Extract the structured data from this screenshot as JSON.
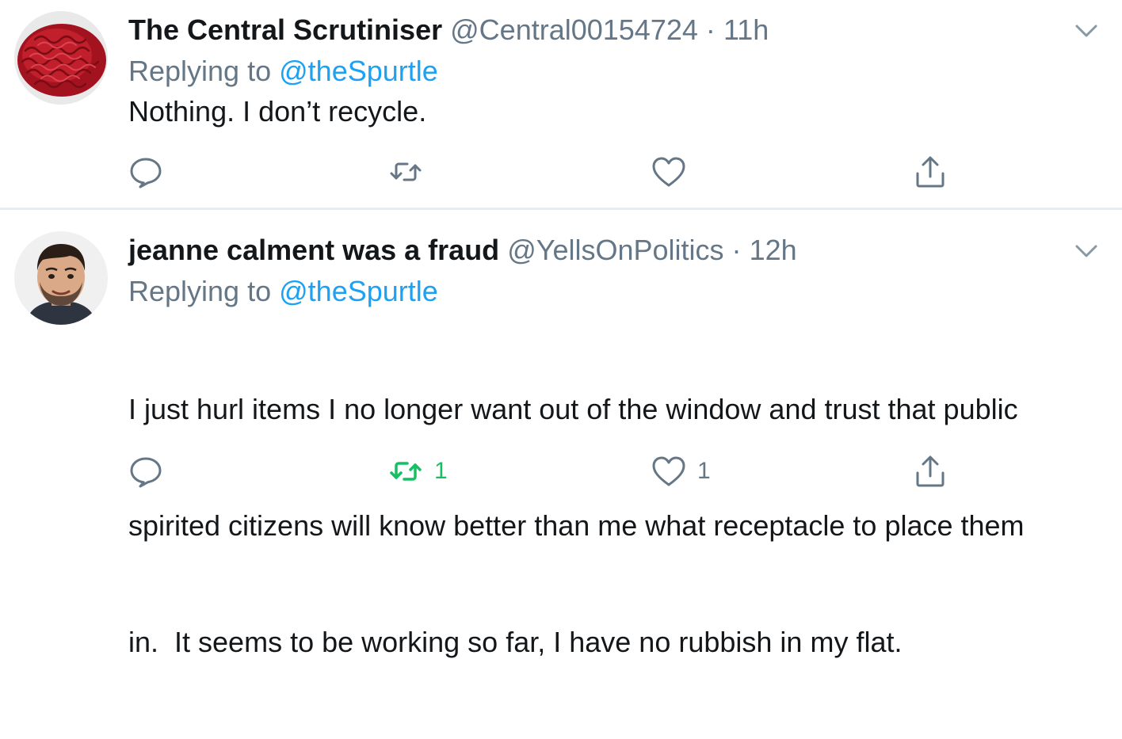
{
  "colors": {
    "text": "#14171a",
    "secondary": "#657786",
    "link": "#1da1f2",
    "retweet_active": "#17bf63",
    "divider": "#e6ecf0"
  },
  "tweets": [
    {
      "display_name": "The Central Scrutiniser",
      "handle": "@Central00154724",
      "separator": "·",
      "time": "11h",
      "replying_prefix": "Replying to",
      "replying_to": "@theSpurtle",
      "text": "Nothing. I don’t recycle.",
      "avatar_icon": "minced-meat-avatar",
      "actions": {
        "reply_count": "",
        "retweet_count": "",
        "like_count": "",
        "retweeted": false
      }
    },
    {
      "display_name": "jeanne calment was a fraud",
      "handle": "@YellsOnPolitics",
      "separator": "·",
      "time": "12h",
      "replying_prefix": "Replying to",
      "replying_to": "@theSpurtle",
      "text_lines": [
        "I just hurl items I no longer want out of the window and trust that public",
        "spirited citizens will know better than me what receptacle to place them",
        "in.  It seems to be working so far, I have no rubbish in my flat."
      ],
      "avatar_icon": "man-face-avatar",
      "actions": {
        "reply_count": "",
        "retweet_count": "1",
        "like_count": "1",
        "retweeted": true
      }
    }
  ]
}
